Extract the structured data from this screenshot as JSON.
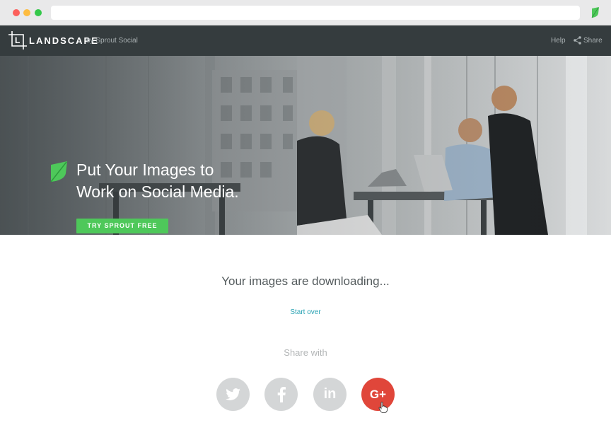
{
  "browser": {
    "url": "",
    "extension_icon": "sprout-leaf-icon"
  },
  "header": {
    "logo_text": "LANDSCAPE",
    "logo_by": "by Sprout Social",
    "help_label": "Help",
    "share_label": "Share"
  },
  "hero": {
    "headline_line1": "Put Your Images to",
    "headline_line2": "Work on Social Media.",
    "cta_label": "TRY SPROUT FREE"
  },
  "main": {
    "status": "Your images are downloading...",
    "start_over": "Start over",
    "share_with": "Share with"
  },
  "social": [
    {
      "name": "twitter",
      "icon": "twitter-icon"
    },
    {
      "name": "facebook",
      "icon": "facebook-icon"
    },
    {
      "name": "linkedin",
      "icon": "linkedin-icon",
      "glyph": "in"
    },
    {
      "name": "google-plus",
      "icon": "google-plus-icon",
      "glyph": "G+"
    }
  ],
  "colors": {
    "header_bg": "#353c3e",
    "cta_green": "#4ec85a",
    "link_teal": "#2aa3b4",
    "google_red": "#e0463a",
    "social_gray": "#d4d6d7"
  }
}
